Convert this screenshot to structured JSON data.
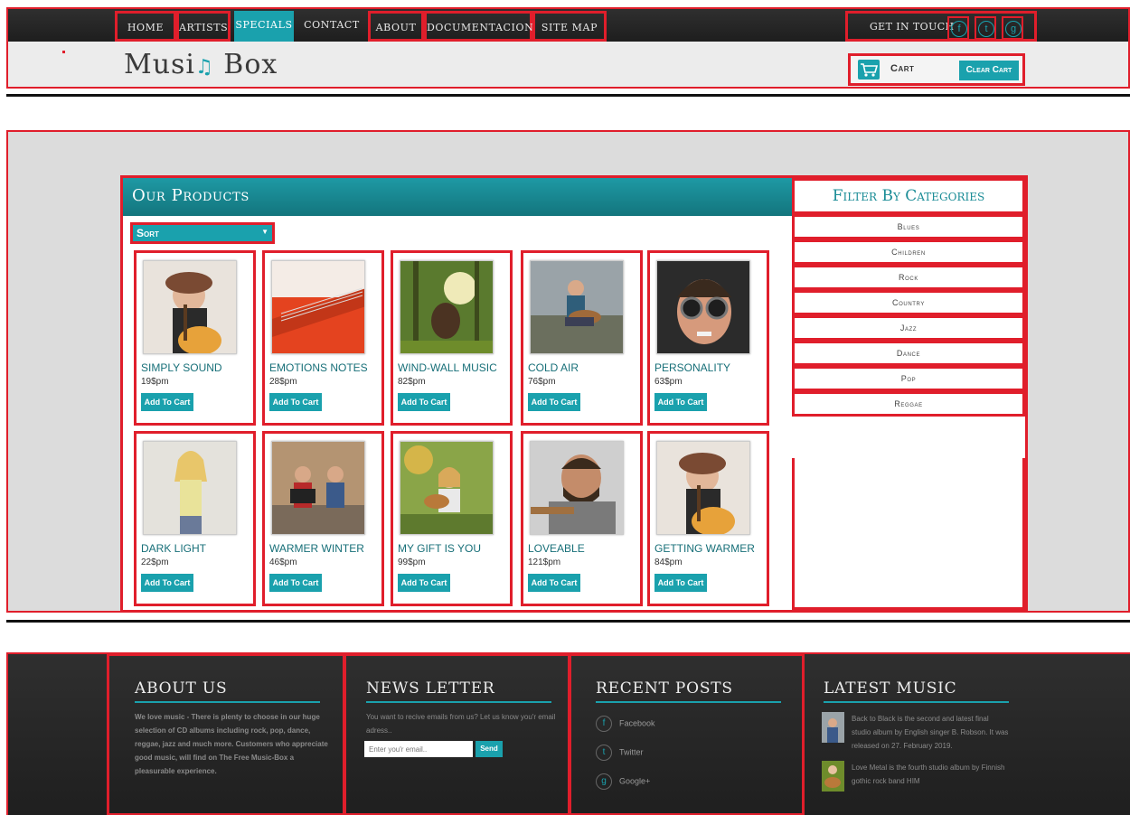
{
  "nav": {
    "items": [
      "HOME",
      "ARTISTS",
      "SPECIALS",
      "CONTACT",
      "ABOUT",
      "DOCUMENTACION",
      "SITE MAP"
    ],
    "active": "SPECIALS",
    "get_in_touch": "GET IN TOUCH",
    "social_icons": [
      "facebook-icon",
      "twitter-icon",
      "google-plus-icon"
    ]
  },
  "logo": {
    "text_start": "Musi",
    "text_end": " Box"
  },
  "cart": {
    "label": "Cart",
    "clear_label": "Clear Cart"
  },
  "products": {
    "title": "Our Products",
    "sort_label": "Sort",
    "add_label": "Add To Cart",
    "items": [
      {
        "name": "SIMPLY SOUND",
        "price": "19$pm"
      },
      {
        "name": "EMOTIONS NOTES",
        "price": "28$pm"
      },
      {
        "name": "WIND-WALL MUSIC",
        "price": "82$pm"
      },
      {
        "name": "COLD AIR",
        "price": "76$pm"
      },
      {
        "name": "PERSONALITY",
        "price": "63$pm"
      },
      {
        "name": "DARK LIGHT",
        "price": "22$pm"
      },
      {
        "name": "WARMER WINTER",
        "price": "46$pm"
      },
      {
        "name": "MY GIFT IS YOU",
        "price": "99$pm"
      },
      {
        "name": "LOVEABLE",
        "price": "121$pm"
      },
      {
        "name": "GETTING WARMER",
        "price": "84$pm"
      }
    ]
  },
  "filter": {
    "title": "Filter By Categories",
    "categories": [
      "Blues",
      "Children",
      "Rock",
      "Country",
      "Jazz",
      "Dance",
      "Pop",
      "Reggae"
    ]
  },
  "footer": {
    "about": {
      "title": "ABOUT US",
      "text": "We love music - There is plenty to choose in our huge selection of CD albums including rock, pop, dance, reggae, jazz and much more. Customers who appreciate good music, will find on The Free Music-Box a pleasurable experience."
    },
    "newsletter": {
      "title": "NEWS LETTER",
      "text": "You want to recive emails from us? Let us know you'r email adress..",
      "placeholder": "Enter you'r email..",
      "send_label": "Send"
    },
    "recent": {
      "title": "RECENT POSTS",
      "links": [
        "Facebook",
        "Twitter",
        "Google+"
      ]
    },
    "latest": {
      "title": "LATEST MUSIC",
      "items": [
        "Back to Black is the second and latest final studio album by English singer B. Robson. It was released on 27. February 2019.",
        "Love Metal is the fourth studio album by Finnish gothic rock band HIM"
      ]
    }
  },
  "colors": {
    "accent": "#1aa1ad",
    "outline": "#e01e2b",
    "dark": "#262626"
  }
}
